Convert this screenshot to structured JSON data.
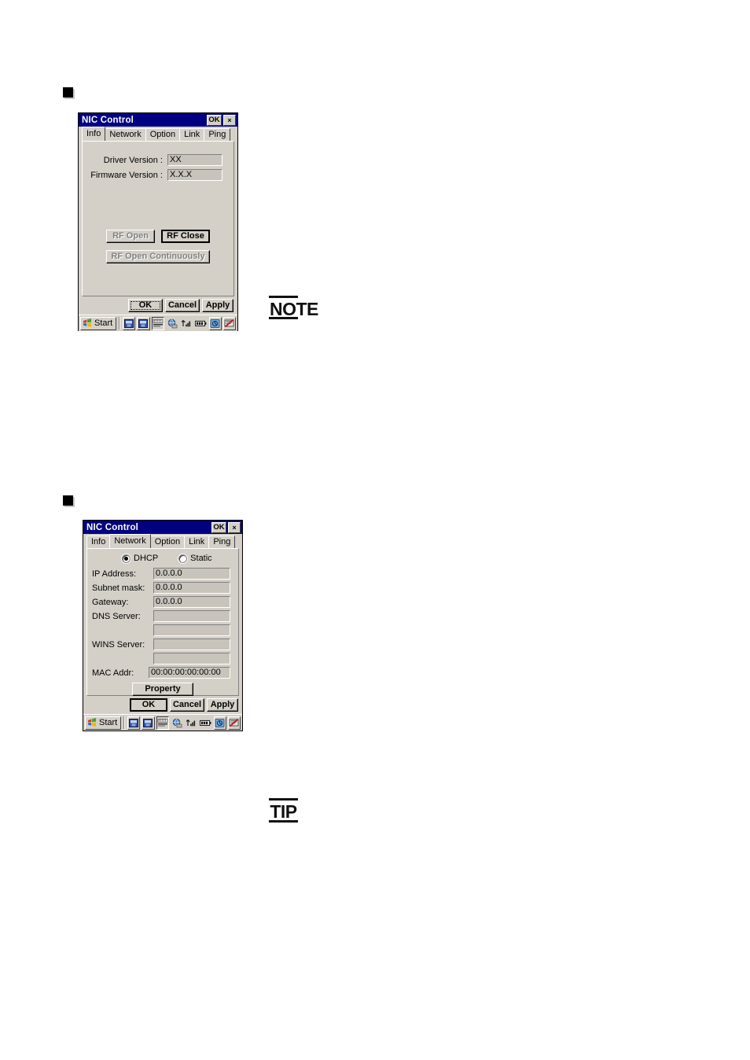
{
  "page": {
    "bullets": [
      {
        "name": "section-bullet-1"
      },
      {
        "name": "section-bullet-2"
      }
    ],
    "stamps": [
      {
        "label": "NOTE",
        "name": "note-stamp"
      },
      {
        "label": "TIP",
        "name": "tip-stamp"
      }
    ]
  },
  "colors": {
    "titlebar": "#000080",
    "window_face": "#d4d0c8",
    "field_face": "#c8c4bc",
    "text": "#000000",
    "disabled_text": "#808080"
  },
  "dialog_info": {
    "title": "NIC Control",
    "titlebar_buttons": {
      "ok_label": "OK",
      "close_label": "×"
    },
    "tabs": [
      {
        "label": "Info",
        "selected": true
      },
      {
        "label": "Network",
        "selected": false
      },
      {
        "label": "Option",
        "selected": false
      },
      {
        "label": "Link",
        "selected": false
      },
      {
        "label": "Ping",
        "selected": false
      }
    ],
    "fields": [
      {
        "label": "Driver Version :",
        "value": "XX"
      },
      {
        "label": "Firmware Version :",
        "value": "X.X.X"
      }
    ],
    "buttons": [
      {
        "label": "RF Open",
        "state": "disabled"
      },
      {
        "label": "RF Close",
        "state": "default"
      },
      {
        "label": "RF Open Continuously",
        "state": "disabled"
      }
    ],
    "footer_buttons": [
      {
        "label": "OK",
        "state": "focused"
      },
      {
        "label": "Cancel",
        "state": "normal"
      },
      {
        "label": "Apply",
        "state": "normal"
      }
    ],
    "taskbar": {
      "start_label": "Start"
    }
  },
  "dialog_network": {
    "title": "NIC Control",
    "titlebar_buttons": {
      "ok_label": "OK",
      "close_label": "×"
    },
    "tabs": [
      {
        "label": "Info",
        "selected": false
      },
      {
        "label": "Network",
        "selected": true
      },
      {
        "label": "Option",
        "selected": false
      },
      {
        "label": "Link",
        "selected": false
      },
      {
        "label": "Ping",
        "selected": false
      }
    ],
    "radios": [
      {
        "label": "DHCP",
        "checked": true
      },
      {
        "label": "Static",
        "checked": false
      }
    ],
    "fields": [
      {
        "label": "IP Address:",
        "value": "0.0.0.0"
      },
      {
        "label": "Subnet mask:",
        "value": "0.0.0.0"
      },
      {
        "label": "Gateway:",
        "value": "0.0.0.0"
      },
      {
        "label": "DNS Server:",
        "value": ""
      },
      {
        "label": "",
        "value": ""
      },
      {
        "label": "WINS Server:",
        "value": ""
      },
      {
        "label": "",
        "value": ""
      },
      {
        "label": "MAC Addr:",
        "value": "00:00:00:00:00:00"
      }
    ],
    "property_button": "Property",
    "footer_buttons": [
      {
        "label": "OK",
        "state": "default"
      },
      {
        "label": "Cancel",
        "state": "normal"
      },
      {
        "label": "Apply",
        "state": "normal"
      }
    ],
    "taskbar": {
      "start_label": "Start"
    }
  }
}
